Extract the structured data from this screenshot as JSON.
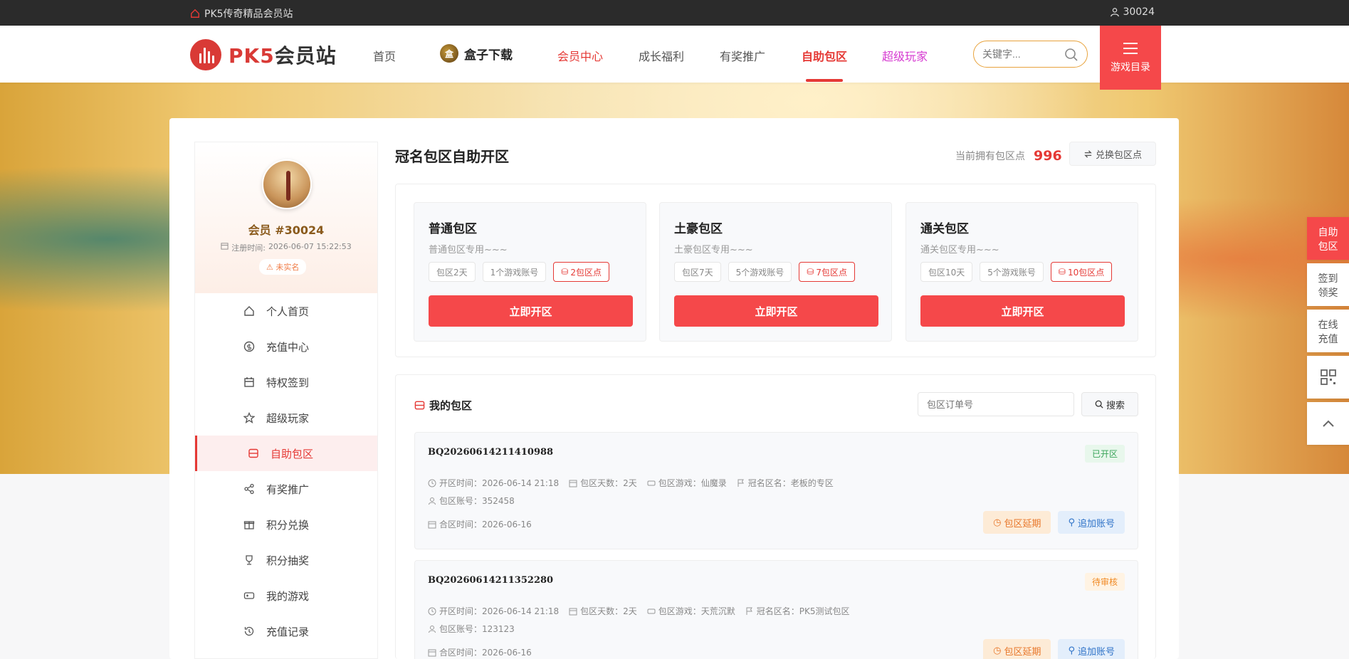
{
  "topbar": {
    "site_name": "PK5传奇精品会员站",
    "user_id": "30024"
  },
  "nav": {
    "logo_prefix": "PK5",
    "logo_suffix": "会员站",
    "items": [
      "首页",
      "会员中心",
      "成长福利",
      "有奖推广",
      "自助包区",
      "超级玩家"
    ],
    "box_download": "盒子下载",
    "box_icon_text": "盒",
    "search_placeholder": "关键字...",
    "game_menu": "游戏目录"
  },
  "profile": {
    "name": "会员 #30024",
    "register_label": "注册时间:",
    "register_time": "2026-06-07 15:22:53",
    "badge": "未实名"
  },
  "sidebar": {
    "items": [
      "个人首页",
      "充值中心",
      "特权签到",
      "超级玩家",
      "自助包区",
      "有奖推广",
      "积分兑换",
      "积分抽奖",
      "我的游戏",
      "充值记录"
    ],
    "active_index": 4
  },
  "page": {
    "title": "冠名包区自助开区",
    "points_label": "当前拥有包区点",
    "points_value": "996",
    "exchange_button": "兑换包区点"
  },
  "packages": [
    {
      "name": "普通包区",
      "desc": "普通包区专用~~~",
      "days": "包区2天",
      "accounts": "1个游戏账号",
      "cost": "2包区点",
      "button": "立即开区"
    },
    {
      "name": "土豪包区",
      "desc": "土豪包区专用~~~",
      "days": "包区7天",
      "accounts": "5个游戏账号",
      "cost": "7包区点",
      "button": "立即开区"
    },
    {
      "name": "通关包区",
      "desc": "通关包区专用~~~",
      "days": "包区10天",
      "accounts": "5个游戏账号",
      "cost": "10包区点",
      "button": "立即开区"
    }
  ],
  "my_zones": {
    "title": "我的包区",
    "order_placeholder": "包区订单号",
    "search_button": "搜索",
    "orders": [
      {
        "id": "BQ20260614211410988",
        "status": "已开区",
        "open_time": "开区时间：2026-06-14 21:18",
        "days": "包区天数：2天",
        "game": "包区游戏：仙魔录",
        "zone_name": "冠名区名：老板的专区",
        "account": "包区账号：352458",
        "merge_time": "合区时间：2026-06-16",
        "extend_button": "包区延期",
        "add_button": "追加账号"
      },
      {
        "id": "BQ20260614211352280",
        "status": "待审核",
        "open_time": "开区时间：2026-06-14 21:18",
        "days": "包区天数：2天",
        "game": "包区游戏：天荒沉默",
        "zone_name": "冠名区名：PK5测试包区",
        "account": "包区账号：123123",
        "merge_time": "合区时间：2026-06-16",
        "extend_button": "包区延期",
        "add_button": "追加账号"
      }
    ]
  },
  "float_menu": [
    "自助\n包区",
    "签到\n领奖",
    "在线\n充值"
  ],
  "colors": {
    "accent": "#f5484a",
    "brand_red": "#e53935",
    "pink": "#d63bd1",
    "gold": "#e8a33d"
  }
}
